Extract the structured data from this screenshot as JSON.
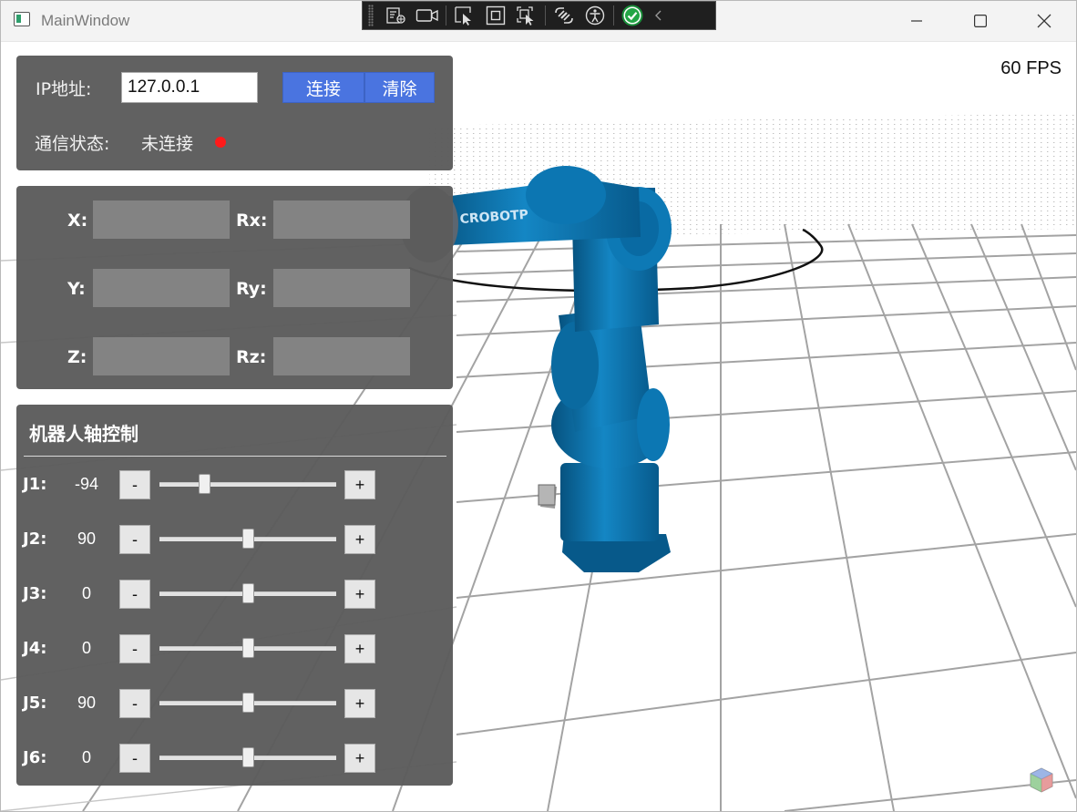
{
  "window": {
    "title": "MainWindow"
  },
  "viewport": {
    "fps_text": "60 FPS",
    "robot_brand": "CROBOTP"
  },
  "connection": {
    "ip_label": "IP地址:",
    "ip_value": "127.0.0.1",
    "connect_label": "连接",
    "clear_label": "清除",
    "status_label": "通信状态:",
    "status_value": "未连接",
    "status_color": "#ff1a1a"
  },
  "pose": {
    "x_label": "X:",
    "y_label": "Y:",
    "z_label": "Z:",
    "rx_label": "Rx:",
    "ry_label": "Ry:",
    "rz_label": "Rz:",
    "x": "",
    "y": "",
    "z": "",
    "rx": "",
    "ry": "",
    "rz": ""
  },
  "axis_control": {
    "title": "机器人轴控制",
    "minus_label": "-",
    "plus_label": "+",
    "joints": [
      {
        "name": "J1:",
        "value": "-94",
        "slider_fraction": 0.24
      },
      {
        "name": "J2:",
        "value": "90",
        "slider_fraction": 0.5
      },
      {
        "name": "J3:",
        "value": "0",
        "slider_fraction": 0.5
      },
      {
        "name": "J4:",
        "value": "0",
        "slider_fraction": 0.5
      },
      {
        "name": "J5:",
        "value": "90",
        "slider_fraction": 0.5
      },
      {
        "name": "J6:",
        "value": "0",
        "slider_fraction": 0.5
      }
    ]
  },
  "colors": {
    "accent": "#4a74e0",
    "panel": "#5c5c5c",
    "robot": "#0a6aa0"
  }
}
